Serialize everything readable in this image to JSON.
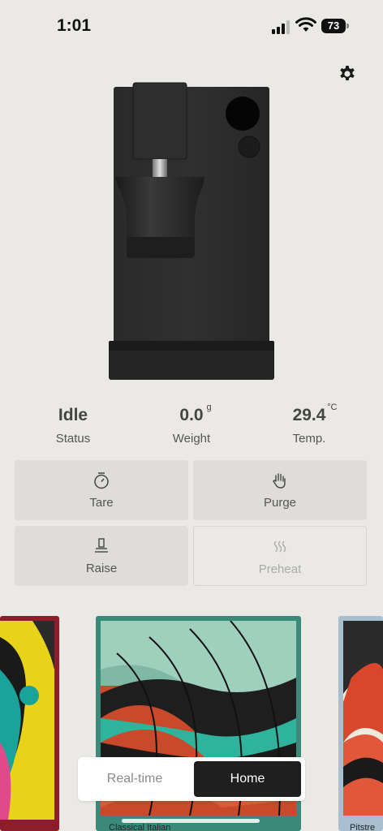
{
  "status_bar": {
    "time": "1:01",
    "battery": "73"
  },
  "stats": [
    {
      "value": "Idle",
      "unit": "",
      "label": "Status"
    },
    {
      "value": "0.0",
      "unit": "g",
      "label": "Weight"
    },
    {
      "value": "29.4",
      "unit": "°C",
      "label": "Temp."
    }
  ],
  "actions": [
    {
      "label": "Tare",
      "icon": "timer-icon",
      "enabled": true
    },
    {
      "label": "Purge",
      "icon": "hand-icon",
      "enabled": true
    },
    {
      "label": "Raise",
      "icon": "raise-icon",
      "enabled": true
    },
    {
      "label": "Preheat",
      "icon": "heat-waves-icon",
      "enabled": false
    }
  ],
  "carousel": {
    "cards": [
      {
        "caption": ""
      },
      {
        "caption": "Classical Italian"
      },
      {
        "caption": "Pitstre"
      }
    ]
  },
  "tabs": {
    "realtime": "Real-time",
    "home": "Home",
    "selected": "Home"
  },
  "colors": {
    "background": "#ebe9e5",
    "selected_tab": "#1f1f1f",
    "card_center_frame": "#3a8a7a",
    "card_left_frame": "#8e1d2c"
  }
}
